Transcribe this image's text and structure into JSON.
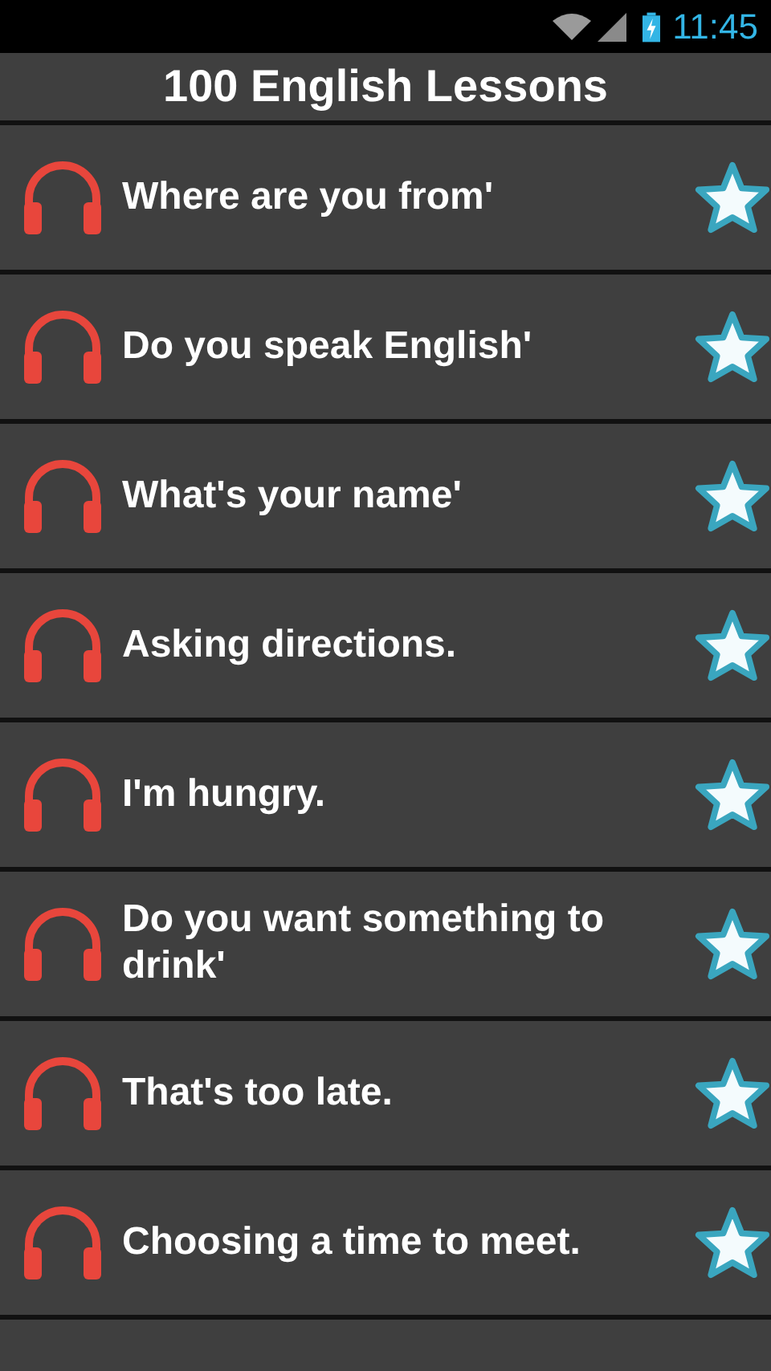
{
  "status_bar": {
    "time": "11:45"
  },
  "title": "100 English Lessons",
  "lessons": [
    {
      "title": "Where are you from'"
    },
    {
      "title": "Do you speak English'"
    },
    {
      "title": "What's your name'"
    },
    {
      "title": "Asking directions."
    },
    {
      "title": "I'm hungry."
    },
    {
      "title": "Do you want something to drink'"
    },
    {
      "title": "That's too late."
    },
    {
      "title": "Choosing a time to meet."
    }
  ]
}
